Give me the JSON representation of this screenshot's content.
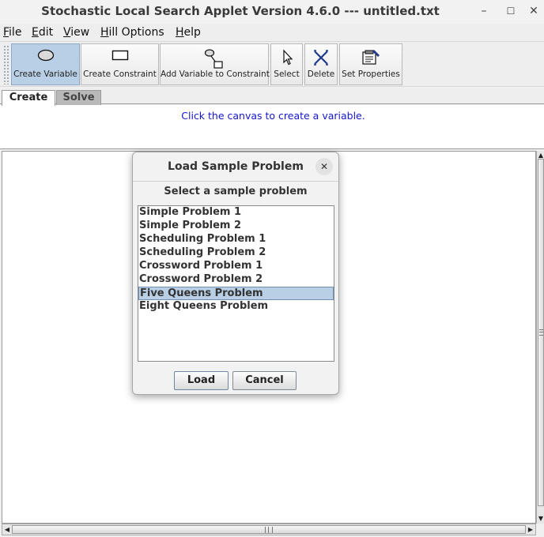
{
  "window": {
    "title": "Stochastic Local Search Applet Version 4.6.0 --- untitled.txt",
    "minimize": "–",
    "maximize": "☐",
    "close": "✕"
  },
  "menubar": {
    "items": [
      {
        "mnemonic": "F",
        "rest": "ile"
      },
      {
        "mnemonic": "E",
        "rest": "dit"
      },
      {
        "mnemonic": "V",
        "rest": "iew"
      },
      {
        "mnemonic": "H",
        "rest": "ill Options"
      },
      {
        "mnemonic": "H",
        "rest": "elp"
      }
    ]
  },
  "toolbar": {
    "create_variable": "Create Variable",
    "create_constraint": "Create Constraint",
    "add_variable_to_constraint": "Add Variable to Constraint",
    "select": "Select",
    "delete": "Delete",
    "set_properties": "Set Properties",
    "active_tool": "Create Variable"
  },
  "tabs": {
    "create": "Create",
    "solve": "Solve",
    "selected": "Create"
  },
  "message": "Click the canvas to create a variable.",
  "dialog": {
    "title": "Load Sample Problem",
    "close": "✕",
    "prompt": "Select a sample problem",
    "items": [
      "Simple Problem 1",
      "Simple Problem 2",
      "Scheduling Problem 1",
      "Scheduling Problem 2",
      "Crossword Problem 1",
      "Crossword Problem 2",
      "Five Queens Problem",
      "Eight Queens Problem"
    ],
    "selected_item": "Five Queens Problem",
    "load": "Load",
    "cancel": "Cancel"
  },
  "scroll": {
    "up": "▲",
    "down": "▼",
    "left": "◀",
    "right": "▶"
  }
}
